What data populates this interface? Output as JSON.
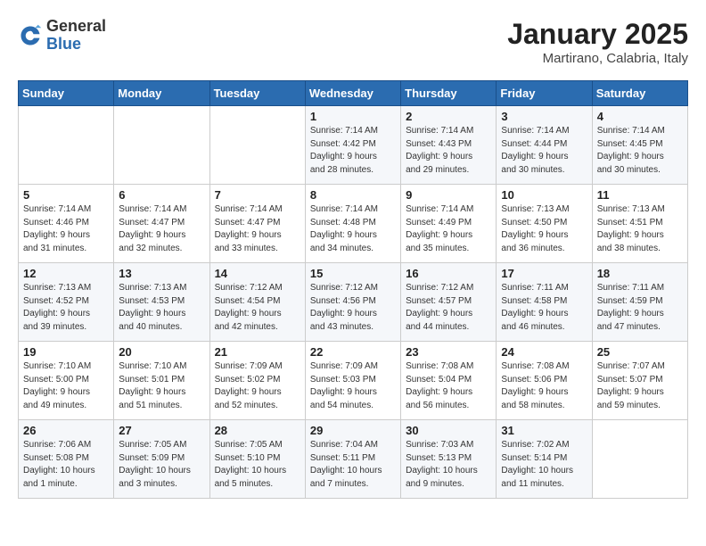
{
  "header": {
    "logo_general": "General",
    "logo_blue": "Blue",
    "title": "January 2025",
    "subtitle": "Martirano, Calabria, Italy"
  },
  "days_of_week": [
    "Sunday",
    "Monday",
    "Tuesday",
    "Wednesday",
    "Thursday",
    "Friday",
    "Saturday"
  ],
  "weeks": [
    [
      {
        "day": "",
        "info": ""
      },
      {
        "day": "",
        "info": ""
      },
      {
        "day": "",
        "info": ""
      },
      {
        "day": "1",
        "info": "Sunrise: 7:14 AM\nSunset: 4:42 PM\nDaylight: 9 hours\nand 28 minutes."
      },
      {
        "day": "2",
        "info": "Sunrise: 7:14 AM\nSunset: 4:43 PM\nDaylight: 9 hours\nand 29 minutes."
      },
      {
        "day": "3",
        "info": "Sunrise: 7:14 AM\nSunset: 4:44 PM\nDaylight: 9 hours\nand 30 minutes."
      },
      {
        "day": "4",
        "info": "Sunrise: 7:14 AM\nSunset: 4:45 PM\nDaylight: 9 hours\nand 30 minutes."
      }
    ],
    [
      {
        "day": "5",
        "info": "Sunrise: 7:14 AM\nSunset: 4:46 PM\nDaylight: 9 hours\nand 31 minutes."
      },
      {
        "day": "6",
        "info": "Sunrise: 7:14 AM\nSunset: 4:47 PM\nDaylight: 9 hours\nand 32 minutes."
      },
      {
        "day": "7",
        "info": "Sunrise: 7:14 AM\nSunset: 4:47 PM\nDaylight: 9 hours\nand 33 minutes."
      },
      {
        "day": "8",
        "info": "Sunrise: 7:14 AM\nSunset: 4:48 PM\nDaylight: 9 hours\nand 34 minutes."
      },
      {
        "day": "9",
        "info": "Sunrise: 7:14 AM\nSunset: 4:49 PM\nDaylight: 9 hours\nand 35 minutes."
      },
      {
        "day": "10",
        "info": "Sunrise: 7:13 AM\nSunset: 4:50 PM\nDaylight: 9 hours\nand 36 minutes."
      },
      {
        "day": "11",
        "info": "Sunrise: 7:13 AM\nSunset: 4:51 PM\nDaylight: 9 hours\nand 38 minutes."
      }
    ],
    [
      {
        "day": "12",
        "info": "Sunrise: 7:13 AM\nSunset: 4:52 PM\nDaylight: 9 hours\nand 39 minutes."
      },
      {
        "day": "13",
        "info": "Sunrise: 7:13 AM\nSunset: 4:53 PM\nDaylight: 9 hours\nand 40 minutes."
      },
      {
        "day": "14",
        "info": "Sunrise: 7:12 AM\nSunset: 4:54 PM\nDaylight: 9 hours\nand 42 minutes."
      },
      {
        "day": "15",
        "info": "Sunrise: 7:12 AM\nSunset: 4:56 PM\nDaylight: 9 hours\nand 43 minutes."
      },
      {
        "day": "16",
        "info": "Sunrise: 7:12 AM\nSunset: 4:57 PM\nDaylight: 9 hours\nand 44 minutes."
      },
      {
        "day": "17",
        "info": "Sunrise: 7:11 AM\nSunset: 4:58 PM\nDaylight: 9 hours\nand 46 minutes."
      },
      {
        "day": "18",
        "info": "Sunrise: 7:11 AM\nSunset: 4:59 PM\nDaylight: 9 hours\nand 47 minutes."
      }
    ],
    [
      {
        "day": "19",
        "info": "Sunrise: 7:10 AM\nSunset: 5:00 PM\nDaylight: 9 hours\nand 49 minutes."
      },
      {
        "day": "20",
        "info": "Sunrise: 7:10 AM\nSunset: 5:01 PM\nDaylight: 9 hours\nand 51 minutes."
      },
      {
        "day": "21",
        "info": "Sunrise: 7:09 AM\nSunset: 5:02 PM\nDaylight: 9 hours\nand 52 minutes."
      },
      {
        "day": "22",
        "info": "Sunrise: 7:09 AM\nSunset: 5:03 PM\nDaylight: 9 hours\nand 54 minutes."
      },
      {
        "day": "23",
        "info": "Sunrise: 7:08 AM\nSunset: 5:04 PM\nDaylight: 9 hours\nand 56 minutes."
      },
      {
        "day": "24",
        "info": "Sunrise: 7:08 AM\nSunset: 5:06 PM\nDaylight: 9 hours\nand 58 minutes."
      },
      {
        "day": "25",
        "info": "Sunrise: 7:07 AM\nSunset: 5:07 PM\nDaylight: 9 hours\nand 59 minutes."
      }
    ],
    [
      {
        "day": "26",
        "info": "Sunrise: 7:06 AM\nSunset: 5:08 PM\nDaylight: 10 hours\nand 1 minute."
      },
      {
        "day": "27",
        "info": "Sunrise: 7:05 AM\nSunset: 5:09 PM\nDaylight: 10 hours\nand 3 minutes."
      },
      {
        "day": "28",
        "info": "Sunrise: 7:05 AM\nSunset: 5:10 PM\nDaylight: 10 hours\nand 5 minutes."
      },
      {
        "day": "29",
        "info": "Sunrise: 7:04 AM\nSunset: 5:11 PM\nDaylight: 10 hours\nand 7 minutes."
      },
      {
        "day": "30",
        "info": "Sunrise: 7:03 AM\nSunset: 5:13 PM\nDaylight: 10 hours\nand 9 minutes."
      },
      {
        "day": "31",
        "info": "Sunrise: 7:02 AM\nSunset: 5:14 PM\nDaylight: 10 hours\nand 11 minutes."
      },
      {
        "day": "",
        "info": ""
      }
    ]
  ]
}
